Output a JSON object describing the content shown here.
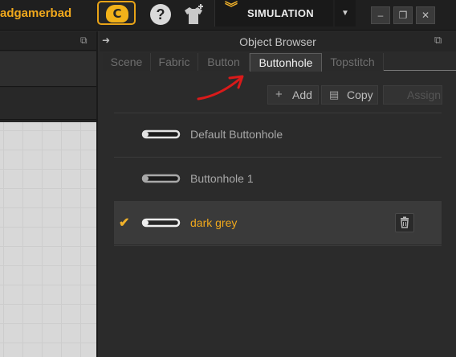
{
  "topbar": {
    "username": "adgamerbad",
    "logo_letter": "C",
    "help_symbol": "?",
    "mode_label": "SIMULATION",
    "mode_dropdown_symbol": "▼",
    "window_buttons": {
      "minimize": "–",
      "restore": "❐",
      "close": "✕"
    }
  },
  "left_panel": {
    "popout_symbol": "⧉"
  },
  "object_browser": {
    "title": "Object Browser",
    "collapse_symbol": "➜",
    "popout_symbol": "⧉",
    "tabs": [
      {
        "label": "Scene",
        "active": false
      },
      {
        "label": "Fabric",
        "active": false
      },
      {
        "label": "Button",
        "active": false
      },
      {
        "label": "Buttonhole",
        "active": true
      },
      {
        "label": "Topstitch",
        "active": false
      }
    ],
    "toolbar": {
      "add": {
        "icon": "+",
        "label": "Add"
      },
      "copy": {
        "icon": "▤",
        "label": "Copy"
      },
      "assign": {
        "label": "Assign",
        "enabled": false
      }
    },
    "items": [
      {
        "name": "Default Buttonhole",
        "selected": false,
        "icon": "buttonhole-icon"
      },
      {
        "name": "Buttonhole 1",
        "selected": false,
        "icon": "buttonhole-icon"
      },
      {
        "name": "dark grey",
        "selected": true,
        "check": "✔",
        "icon": "buttonhole-icon"
      }
    ]
  },
  "colors": {
    "accent": "#f0a81c",
    "annotation_arrow": "#d91a1a",
    "panel_bg": "#2b2b2b"
  }
}
